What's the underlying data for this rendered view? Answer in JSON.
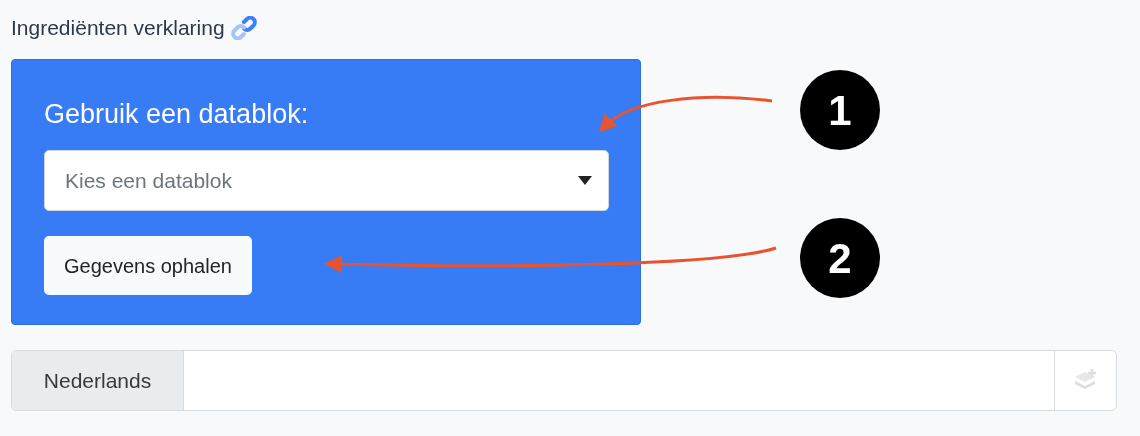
{
  "section_title": "Ingrediënten verklaring",
  "datablock_panel": {
    "heading": "Gebruik een datablok:",
    "select": {
      "placeholder": "Kies een datablok"
    },
    "button": "Gegevens ophalen"
  },
  "language_field": {
    "addon": "Nederlands",
    "disabled": true
  },
  "annotations": [
    {
      "number": "1"
    },
    {
      "number": "2"
    }
  ]
}
